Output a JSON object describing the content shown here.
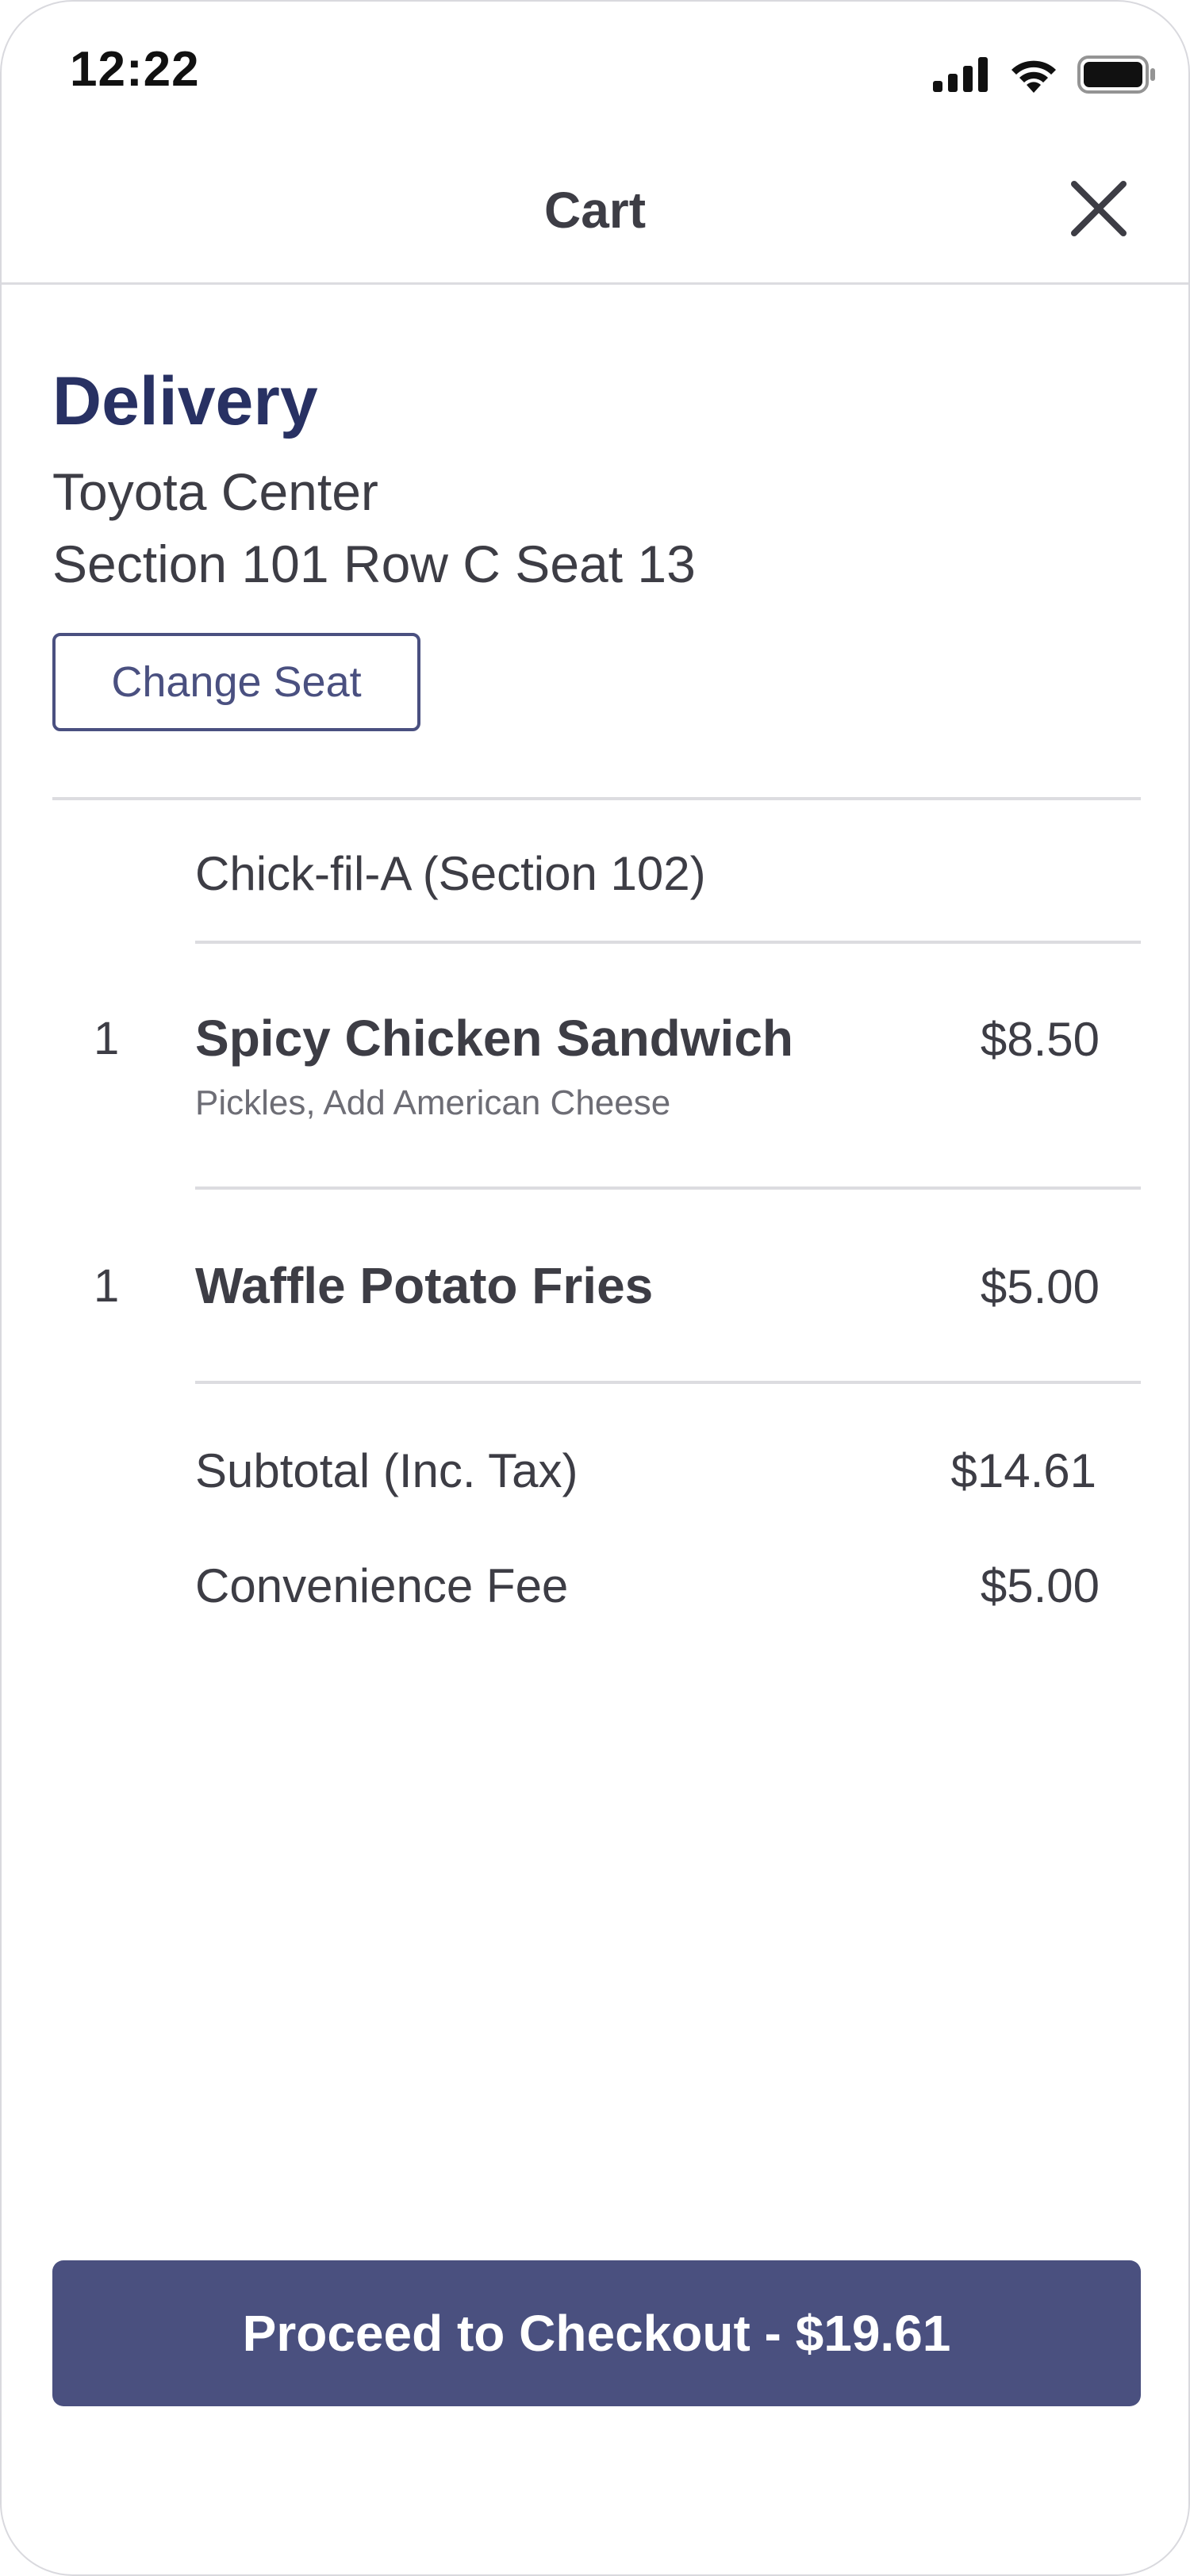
{
  "status_bar": {
    "time": "12:22",
    "icons": [
      "signal-icon",
      "wifi-icon",
      "battery-icon"
    ]
  },
  "header": {
    "title": "Cart",
    "close_icon": "close-icon"
  },
  "delivery": {
    "heading": "Delivery",
    "venue": "Toyota Center",
    "seat": "Section 101 Row C Seat 13",
    "change_seat_label": "Change Seat"
  },
  "order": {
    "vendor": "Chick-fil-A  (Section 102)",
    "items": [
      {
        "qty": "1",
        "name": "Spicy Chicken Sandwich",
        "modifiers": "Pickles, Add American Cheese",
        "price": "$8.50"
      },
      {
        "qty": "1",
        "name": "Waffle Potato Fries",
        "modifiers": "",
        "price": "$5.00"
      }
    ],
    "subtotal_label": "Subtotal (Inc. Tax)",
    "subtotal_value": "$14.61",
    "fee_label": "Convenience Fee",
    "fee_value": "$5.00"
  },
  "checkout": {
    "label": "Proceed to Checkout - $19.61"
  },
  "colors": {
    "accent": "#4a507f",
    "heading": "#283163",
    "text": "#3d3d45",
    "divider": "#dcdce0"
  }
}
